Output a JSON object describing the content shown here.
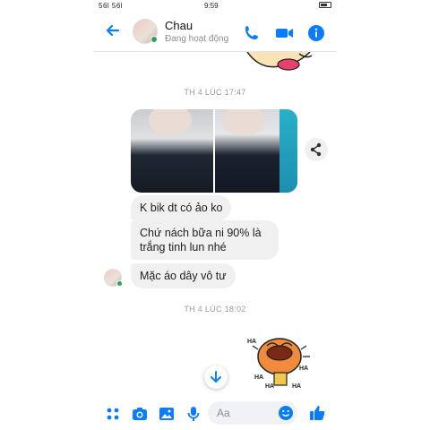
{
  "status_bar": {
    "signal_text": "56l 56l",
    "time": "9:59"
  },
  "header": {
    "contact_name": "Chau",
    "presence": "Đang hoạt động",
    "icons": [
      "back-arrow-icon",
      "phone-icon",
      "video-icon",
      "info-icon"
    ],
    "accent_color": "#0a7cff"
  },
  "conversation": {
    "timestamp_1": "TH 4 LÚC 17:47",
    "messages": [
      {
        "text": "K bik dt có ảo ko"
      },
      {
        "text": "Chứ nách bữa ni 90% là trắng tinh lun nhé"
      },
      {
        "text": "Mặc áo dây vô tư"
      }
    ],
    "timestamp_2": "TH 4 LÚC 18:02",
    "sticker_text": [
      "HA",
      "HA",
      "HA",
      "HA",
      "HA"
    ]
  },
  "composer": {
    "placeholder": "Aa"
  }
}
